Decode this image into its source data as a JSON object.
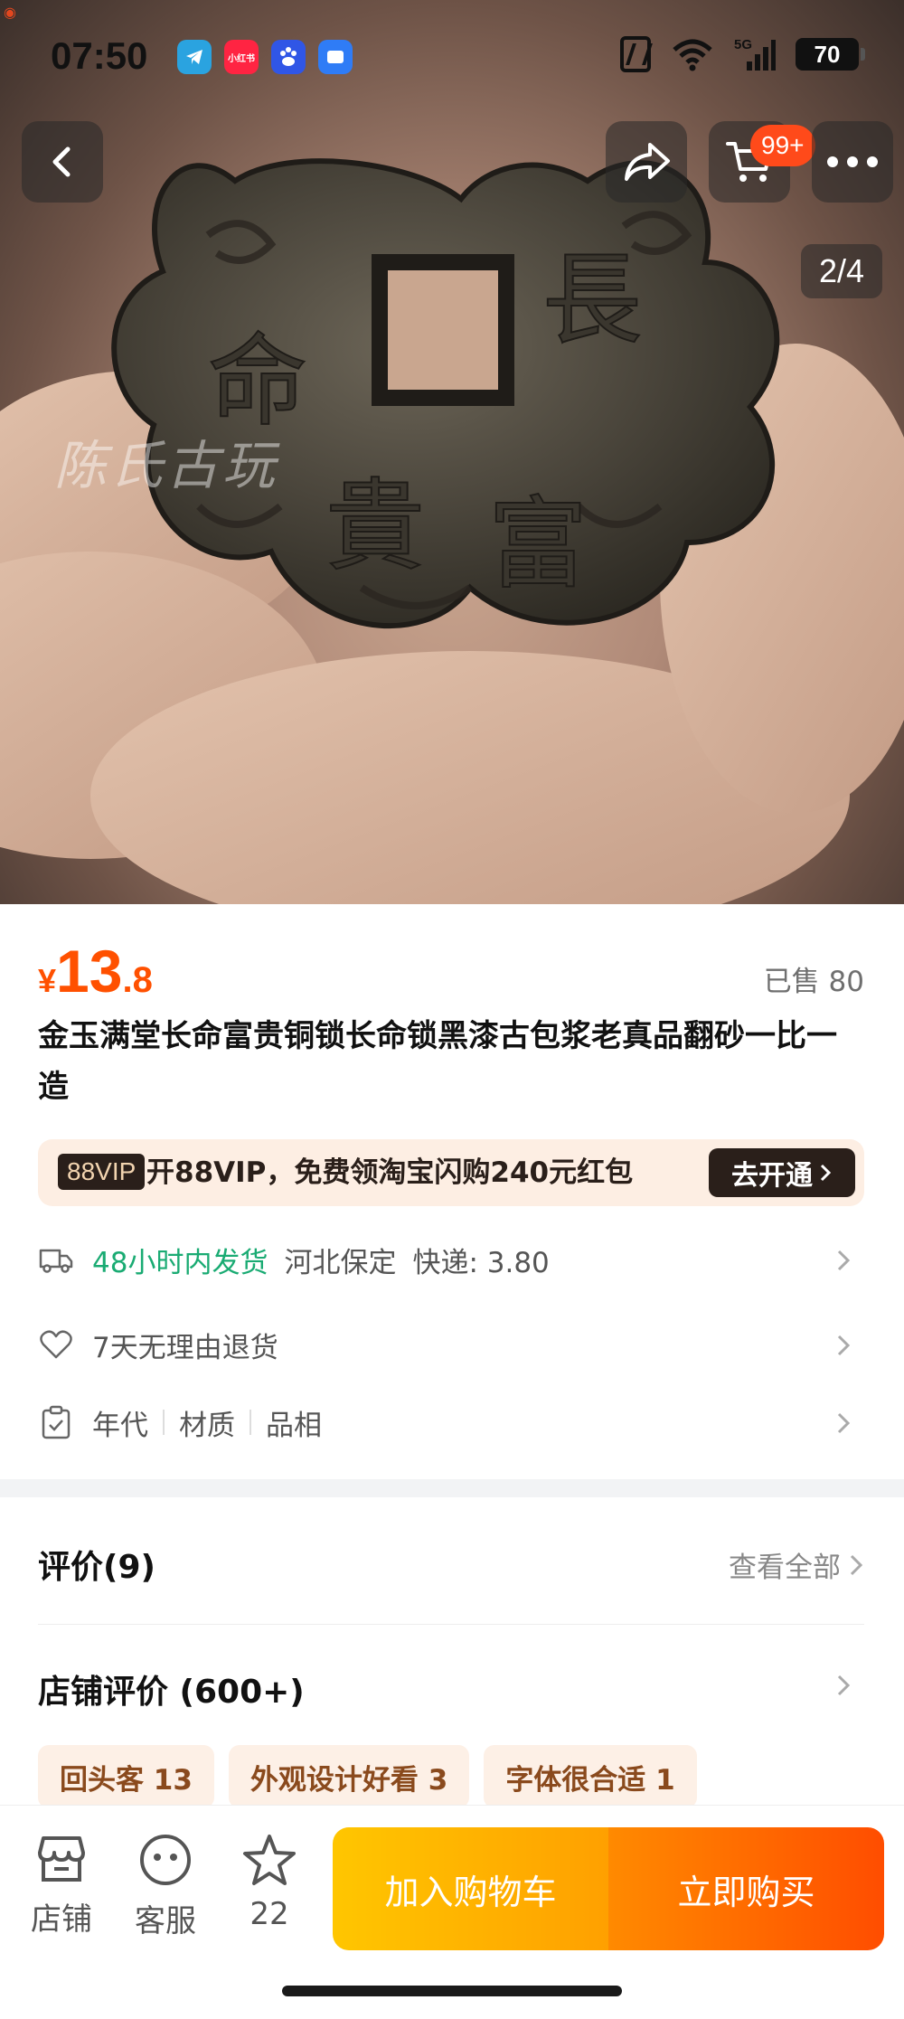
{
  "status_bar": {
    "time": "07:50",
    "battery": "70",
    "apps": [
      {
        "name": "telegram-app-icon",
        "color": "#2aa3e0",
        "label": ""
      },
      {
        "name": "xiaohongshu-app-icon",
        "color": "#ff2442",
        "label": "小红书"
      },
      {
        "name": "baidu-app-icon",
        "color": "#3056e6",
        "label": ""
      },
      {
        "name": "files-app-icon",
        "color": "#2f7cf6",
        "label": ""
      }
    ]
  },
  "gallery": {
    "counter": "2/4",
    "watermark": "陈氏古玩",
    "cart_badge": "99+"
  },
  "product": {
    "price_currency": "¥",
    "price_integer": "13",
    "price_decimal": ".8",
    "sold": "已售 80",
    "title": "金玉满堂长命富贵铜锁长命锁黑漆古包浆老真品翻砂一比一造"
  },
  "vip": {
    "tag": "88VIP",
    "text": "开88VIP，免费领淘宝闪购240元红包",
    "button": "去开通"
  },
  "shipping": {
    "speed": "48小时内发货",
    "origin": "河北保定",
    "fee": "快递: 3.80"
  },
  "returns": {
    "text": "7天无理由退货"
  },
  "params": {
    "items": [
      "年代",
      "材质",
      "品相"
    ]
  },
  "reviews": {
    "title": "评价(9)",
    "see_all": "查看全部"
  },
  "shop_reviews": {
    "title": "店铺评价 (600+)",
    "tags": [
      "回头客 13",
      "外观设计好看 3",
      "字体很合适 1"
    ]
  },
  "bottom_bar": {
    "shop": "店铺",
    "service": "客服",
    "favorites": "22",
    "add_to_cart": "加入购物车",
    "buy_now": "立即购买"
  },
  "colors": {
    "accent": "#ff5000",
    "green": "#1aab73",
    "cart_gradient": [
      "#ffc600",
      "#ffa000"
    ],
    "buy_gradient": [
      "#ff8a00",
      "#ff4d00"
    ]
  }
}
